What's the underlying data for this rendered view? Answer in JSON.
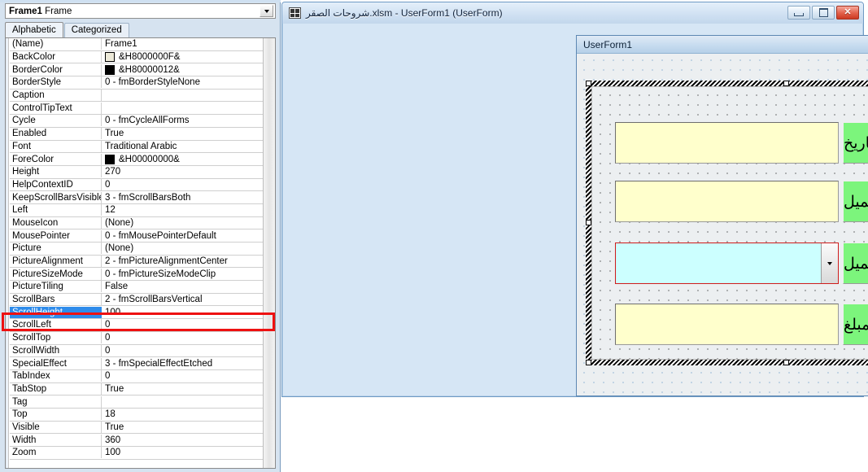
{
  "properties_window": {
    "object_selector": {
      "name": "Frame1",
      "type": "Frame",
      "dropdown_icon": "chevron-down-icon"
    },
    "tabs": [
      {
        "label": "Alphabetic",
        "active": true
      },
      {
        "label": "Categorized",
        "active": false
      }
    ],
    "selected_property": "ScrollHeight",
    "highlight_color": "#2f8ceb",
    "annotation_color": "#ee1111",
    "rows": [
      {
        "name": "(Name)",
        "value": "Frame1",
        "swatch": null
      },
      {
        "name": "BackColor",
        "value": "&H8000000F&",
        "swatch": "#ece9d8"
      },
      {
        "name": "BorderColor",
        "value": "&H80000012&",
        "swatch": "#000000"
      },
      {
        "name": "BorderStyle",
        "value": "0 - fmBorderStyleNone",
        "swatch": null
      },
      {
        "name": "Caption",
        "value": "",
        "swatch": null
      },
      {
        "name": "ControlTipText",
        "value": "",
        "swatch": null
      },
      {
        "name": "Cycle",
        "value": "0 - fmCycleAllForms",
        "swatch": null
      },
      {
        "name": "Enabled",
        "value": "True",
        "swatch": null
      },
      {
        "name": "Font",
        "value": "Traditional Arabic",
        "swatch": null
      },
      {
        "name": "ForeColor",
        "value": "&H00000000&",
        "swatch": "#000000"
      },
      {
        "name": "Height",
        "value": "270",
        "swatch": null
      },
      {
        "name": "HelpContextID",
        "value": "0",
        "swatch": null
      },
      {
        "name": "KeepScrollBarsVisible",
        "value": "3 - fmScrollBarsBoth",
        "swatch": null
      },
      {
        "name": "Left",
        "value": "12",
        "swatch": null
      },
      {
        "name": "MouseIcon",
        "value": "(None)",
        "swatch": null
      },
      {
        "name": "MousePointer",
        "value": "0 - fmMousePointerDefault",
        "swatch": null
      },
      {
        "name": "Picture",
        "value": "(None)",
        "swatch": null
      },
      {
        "name": "PictureAlignment",
        "value": "2 - fmPictureAlignmentCenter",
        "swatch": null
      },
      {
        "name": "PictureSizeMode",
        "value": "0 - fmPictureSizeModeClip",
        "swatch": null
      },
      {
        "name": "PictureTiling",
        "value": "False",
        "swatch": null
      },
      {
        "name": "ScrollBars",
        "value": "2 - fmScrollBarsVertical",
        "swatch": null
      },
      {
        "name": "ScrollHeight",
        "value": "100",
        "swatch": null,
        "selected": true
      },
      {
        "name": "ScrollLeft",
        "value": "0",
        "swatch": null
      },
      {
        "name": "ScrollTop",
        "value": "0",
        "swatch": null
      },
      {
        "name": "ScrollWidth",
        "value": "0",
        "swatch": null
      },
      {
        "name": "SpecialEffect",
        "value": "3 - fmSpecialEffectEtched",
        "swatch": null
      },
      {
        "name": "TabIndex",
        "value": "0",
        "swatch": null
      },
      {
        "name": "TabStop",
        "value": "True",
        "swatch": null
      },
      {
        "name": "Tag",
        "value": "",
        "swatch": null
      },
      {
        "name": "Top",
        "value": "18",
        "swatch": null
      },
      {
        "name": "Visible",
        "value": "True",
        "swatch": null
      },
      {
        "name": "Width",
        "value": "360",
        "swatch": null
      },
      {
        "name": "Zoom",
        "value": "100",
        "swatch": null
      }
    ]
  },
  "mdi_window": {
    "title": "شروحات الصقر.xlsm - UserForm1 (UserForm)",
    "icon": "userform-icon",
    "buttons": {
      "minimize": "minimize-icon",
      "restore": "restore-icon",
      "close": "✕"
    }
  },
  "userform_window": {
    "title": "UserForm1",
    "close_glyph": "✕"
  },
  "frame_control": {
    "name": "Frame1",
    "selected": true,
    "scrollbar": {
      "up_glyph": "scroll-up-arrow",
      "down_glyph": "scroll-down-arrow"
    },
    "controls": [
      {
        "label": "التاريخ",
        "input_type": "textbox",
        "input_value": "",
        "input_color": "#ffffcc",
        "label_color": "#7cf57c"
      },
      {
        "label": "كود العميل",
        "input_type": "textbox",
        "input_value": "",
        "input_color": "#ffffcc",
        "label_color": "#7cf57c"
      },
      {
        "label": "اسم العميل",
        "input_type": "combobox",
        "input_value": "",
        "input_color": "#ccffff",
        "label_color": "#7cf57c",
        "selected": true,
        "dropdown_icon": "chevron-down-icon"
      },
      {
        "label": "المبلغ",
        "input_type": "textbox",
        "input_value": "",
        "input_color": "#ffffcc",
        "label_color": "#7cf57c"
      }
    ]
  }
}
